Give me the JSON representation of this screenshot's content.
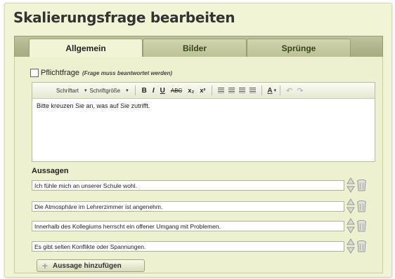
{
  "dialog": {
    "title": "Skalierungsfrage bearbeiten"
  },
  "tabs": [
    {
      "label": "Allgemein",
      "active": true
    },
    {
      "label": "Bilder",
      "active": false
    },
    {
      "label": "Sprünge",
      "active": false
    }
  ],
  "mandatory": {
    "label": "Pflichtfrage",
    "note": "(Frage muss beantwortet werden)",
    "checked": false
  },
  "editor": {
    "font_label": "Schriftart",
    "size_label": "Schriftgröße",
    "buttons": {
      "bold": "B",
      "italic": "I",
      "underline": "U",
      "strike": "ABC",
      "subscript": "x₂",
      "superscript": "x²",
      "font_color": "A"
    },
    "content": "Bitte kreuzen Sie an, was auf Sie zutrifft."
  },
  "statements": {
    "label": "Aussagen",
    "items": [
      "Ich fühle mich an unserer Schule wohl.",
      "Die Atmosphäre im Lehrerzimmer ist angenehm.",
      "Innerhalb des Kollegiums herrscht ein offener Umgang mit Problemen.",
      "Es gibt selten Konflikte oder Spannungen."
    ],
    "add_label": "Aussage hinzufügen"
  },
  "icons": {
    "sort": "up-down-arrows-icon",
    "delete": "trash-icon",
    "add": "plus-icon"
  }
}
